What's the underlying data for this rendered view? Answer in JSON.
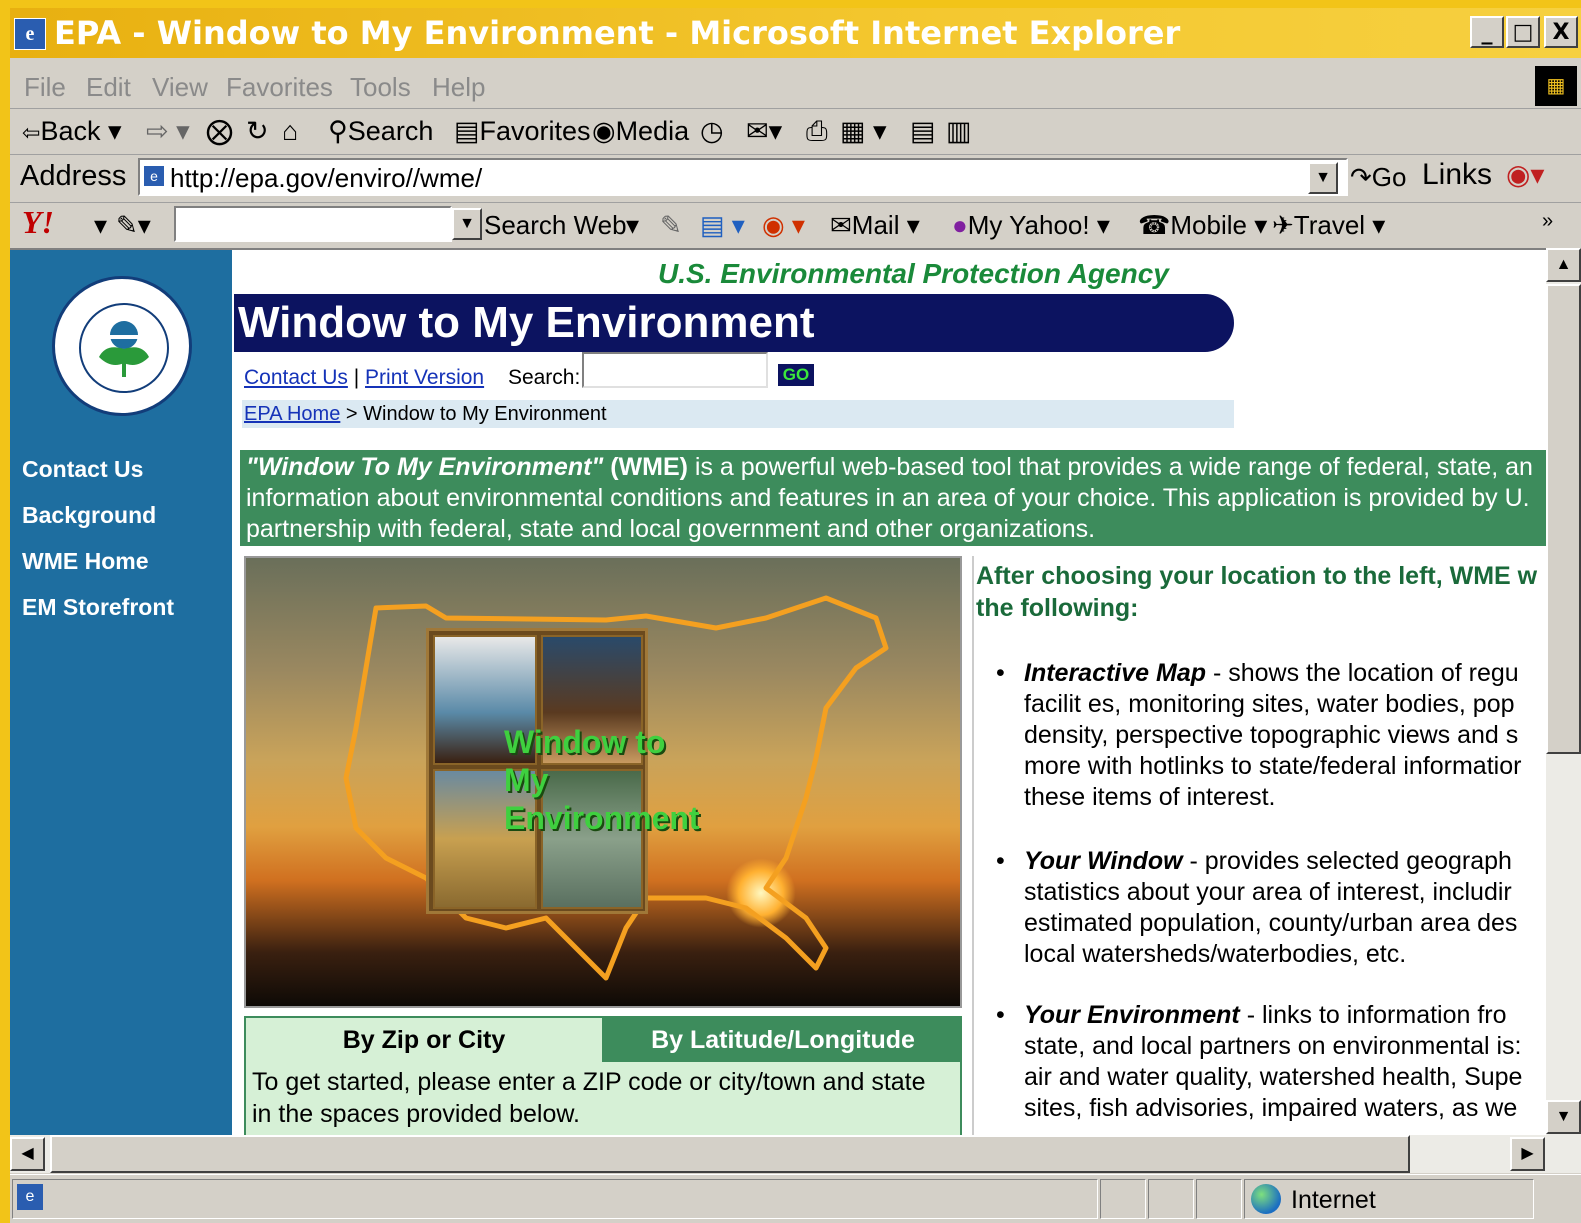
{
  "window": {
    "title": "EPA - Window to My Environment - Microsoft Internet Explorer",
    "min": "_",
    "restore": "ð",
    "close": "X"
  },
  "menu": [
    "File",
    "Edit",
    "View",
    "Favorites",
    "Tools",
    "Help"
  ],
  "toolbar": {
    "back": "Back",
    "search": "Search",
    "favorites": "Favorites",
    "media": "Media"
  },
  "address": {
    "label": "Address",
    "url": "http://epa.gov/enviro//wme/",
    "go": "Go",
    "links": "Links"
  },
  "yahoo": {
    "logo": "Y!",
    "search_web": "Search Web",
    "mail": "Mail",
    "my_yahoo": "My Yahoo!",
    "mobile": "Mobile",
    "travel": "Travel",
    "more": "»"
  },
  "page": {
    "agency": "U.S. Environmental Protection Agency",
    "title": "Window to My Environment",
    "contact": "Contact Us",
    "sep": "|",
    "print": "Print Version",
    "search_label": "Search:",
    "go_btn": "GO",
    "crumb_home": "EPA Home",
    "crumb_rest": " > Window to My Environment",
    "nav": [
      "Contact Us",
      "Background",
      "WME Home",
      "EM Storefront"
    ],
    "intro_title": "\"Window To My Environment\"",
    "intro_abbr": " (WME)",
    "intro_line1": " is a powerful web-based tool that provides a wide range of federal, state, an",
    "intro_line2": "information about environmental conditions and features in an area of your choice. This application is provided by U.",
    "intro_line3": "partnership with federal, state and local government and other organizations.",
    "logo_text": [
      "Window to",
      "My",
      "Environment"
    ],
    "tab_zip": "By Zip or City",
    "tab_latlong": "By Latitude/Longitude",
    "tab_text1": "To get started, please enter a ZIP code or city/town and state",
    "tab_text2": "in the spaces provided below.",
    "right_head1": "After choosing your location to the left, WME w",
    "right_head2": "the following:",
    "bullets": [
      {
        "title": "Interactive Map",
        "lines": [
          " - shows the location of regu",
          "facilit es, monitoring sites, water bodies, pop",
          "density, perspective topographic views and s",
          "more with hotlinks to state/federal informatior",
          "these items of interest."
        ]
      },
      {
        "title": "Your Window",
        "lines": [
          " - provides selected geograph",
          "statistics about your area of interest, includir",
          "estimated population, county/urban area des",
          "local watersheds/waterbodies, etc."
        ]
      },
      {
        "title": "Your Environment",
        "lines": [
          " - links to information fro",
          "state, and local partners on environmental is:",
          "air and water quality, watershed health, Supe",
          "sites, fish advisories, impaired waters, as we"
        ]
      }
    ]
  },
  "status": {
    "zone": "Internet"
  }
}
